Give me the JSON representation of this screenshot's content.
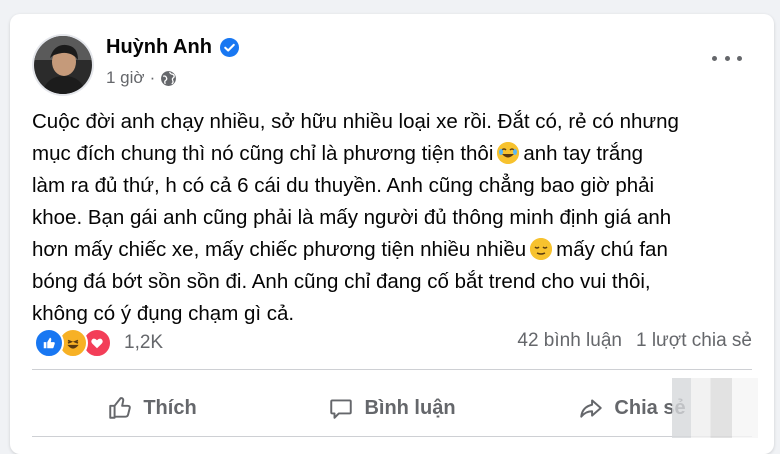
{
  "post": {
    "author": "Huỳnh Anh",
    "time": "1 giờ",
    "icons": {
      "verified": "verified-badge-icon",
      "audience": "globe-icon",
      "more": "more-options-icon"
    },
    "text_lines": [
      "Cuộc đời anh chạy nhiều, sở hữu nhiều loại xe rồi. Đắt có, rẻ có nhưng",
      "mục đích chung thì nó cũng chỉ là phương tiện thôi",
      "anh tay trắng",
      "làm ra đủ thứ, h có cả 6 cái du thuyền. Anh cũng chẳng bao giờ phải",
      "khoe. Bạn gái anh cũng phải là mấy người đủ thông minh định giá anh",
      "hơn mấy chiếc xe, mấy chiếc phương tiện nhiều nhiều",
      "mấy chú fan",
      "bóng đá bớt sồn sồn đi. Anh cũng chỉ đang cố bắt trend cho vui thôi,",
      "không có ý đụng chạm gì cả."
    ],
    "inline_emojis": [
      "laughing-crying-emoji",
      "relieved-emoji"
    ]
  },
  "reactions": {
    "icons": [
      "like-reaction-icon",
      "haha-reaction-icon",
      "love-reaction-icon"
    ],
    "count": "1,2K"
  },
  "stats": {
    "comments": "42 bình luận",
    "shares": "1 lượt chia sẻ"
  },
  "actions": {
    "like": "Thích",
    "comment": "Bình luận",
    "share": "Chia sẻ"
  },
  "colors": {
    "facebook_blue": "#1877f2",
    "love_red": "#f33e58",
    "haha_yellow": "#f7b125",
    "secondary_text": "#65676b"
  }
}
